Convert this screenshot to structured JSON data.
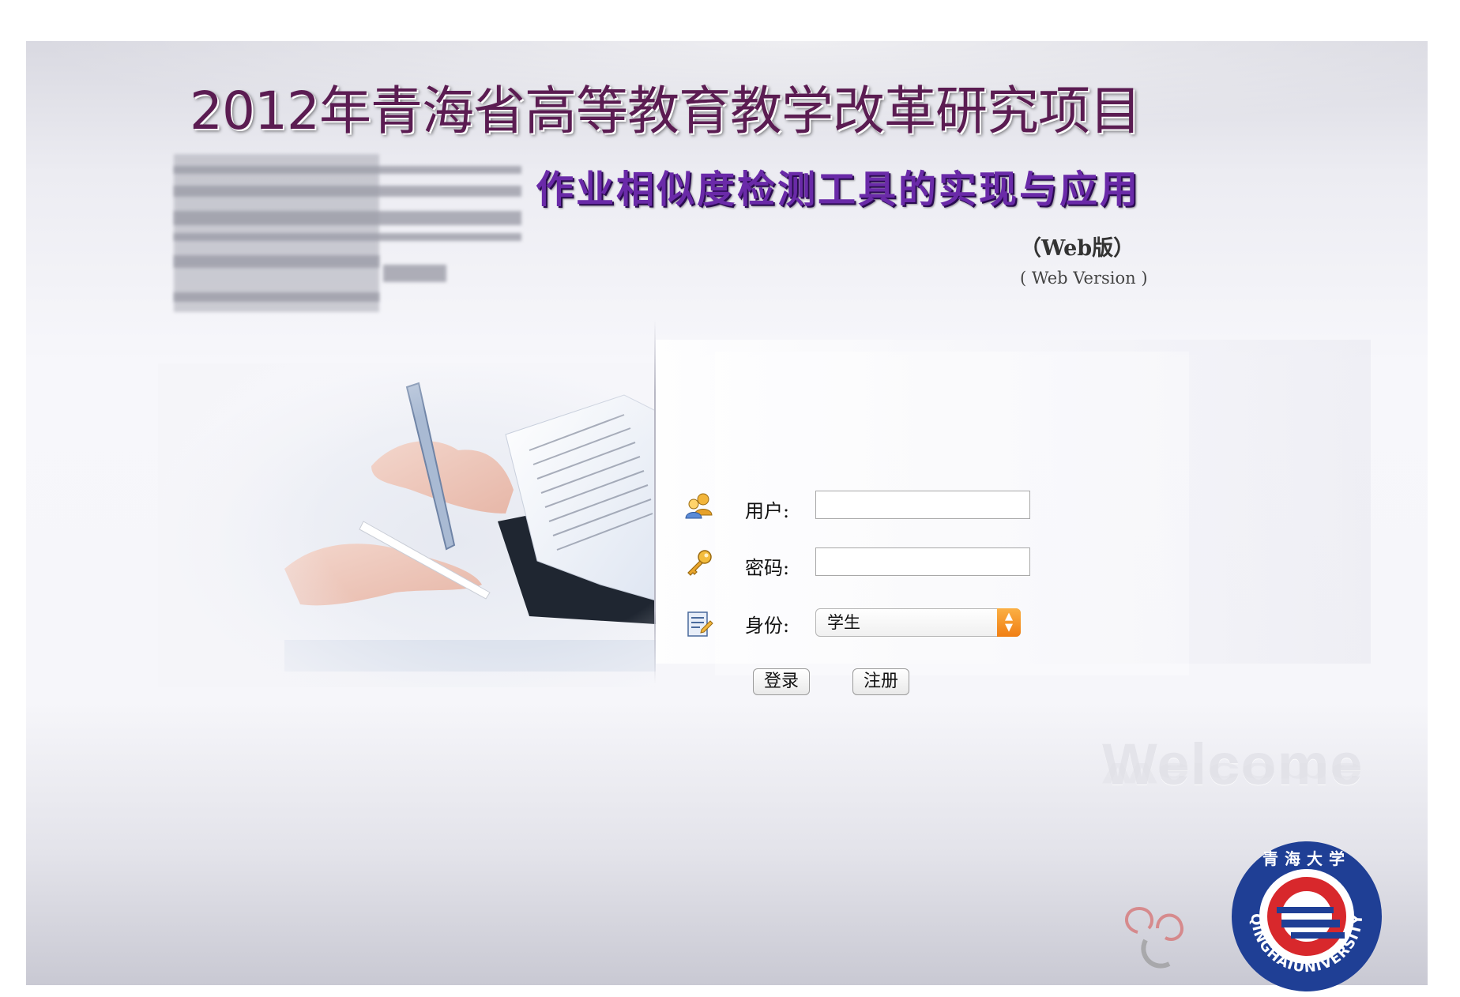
{
  "header": {
    "title": "2012年青海省高等教育教学改革研究项目",
    "subtitle": "作业相似度检测工具的实现与应用",
    "version_cn": "（Web版）",
    "version_en": "( Web Version )"
  },
  "login": {
    "user_label": "用户:",
    "user_value": "",
    "password_label": "密码:",
    "password_value": "",
    "role_label": "身份:",
    "role_selected": "学生",
    "login_button": "登录",
    "register_button": "注册"
  },
  "decor": {
    "welcome_text": "Welcome",
    "logo_text_bottom": "QINGHAIUNIVERSITY",
    "logo_text_top": "青海大学"
  },
  "colors": {
    "title": "#5b1c52",
    "subtitle": "#6a2aa8",
    "select_arrow": "#f58a1f",
    "logo_blue": "#1f3f95",
    "logo_red": "#d8282c"
  },
  "icons": [
    "users-icon",
    "key-icon",
    "id-card-icon",
    "select-arrows-icon"
  ]
}
